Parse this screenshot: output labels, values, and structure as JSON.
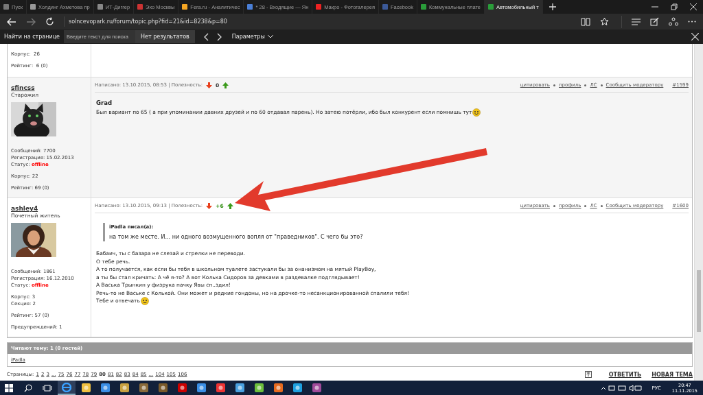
{
  "browser": {
    "tabs": [
      {
        "title": "Пуск",
        "selected": false
      },
      {
        "title": "Холдинг Ахметова пр",
        "selected": false
      },
      {
        "title": "ИТ-Диггер",
        "selected": false
      },
      {
        "title": "Эхо Москвы",
        "selected": false
      },
      {
        "title": "Fera.ru - Аналитичес",
        "selected": false
      },
      {
        "title": "* 28 - Входящие — Ян",
        "selected": false
      },
      {
        "title": "Макро - Фотогалерея",
        "selected": false
      },
      {
        "title": "Facebook",
        "selected": false
      },
      {
        "title": "Коммунальные плате",
        "selected": false
      },
      {
        "title": "Автомобильный т",
        "selected": true
      }
    ],
    "url": "solncevopark.ru/forum/topic.php?fid=21&id=8238&p=80",
    "find": {
      "label": "Найти на странице",
      "placeholder": "Введите текст для поиска",
      "result": "Нет результатов",
      "options": "Параметры"
    }
  },
  "forum": {
    "partial_row": {
      "stat_groups": [
        [
          {
            "label": "Корпус:",
            "value": "26"
          }
        ],
        [
          {
            "label": "Рейтинг:",
            "value": "6 (0)"
          }
        ]
      ]
    },
    "posts": [
      {
        "author": "sfincss",
        "rank": "Старожил",
        "stat_groups": [
          [
            {
              "label": "Сообщений:",
              "value": "7700",
              "kind": "plain"
            },
            {
              "label": "Регистрация:",
              "value": "15.02.2013",
              "kind": "plain"
            },
            {
              "label": "Статус:",
              "value": "offline",
              "kind": "status"
            }
          ],
          [
            {
              "label": "Корпус:",
              "value": "22",
              "kind": "plain"
            }
          ],
          [
            {
              "label": "Рейтинг:",
              "value": "69 (0)",
              "kind": "plain"
            }
          ]
        ],
        "written": "Написано: 13.10.2015, 08:53 | Полезность:",
        "score": "0",
        "positive": false,
        "actions": [
          "цитировать",
          "профиль",
          "ЛС",
          "Сообщить модератору"
        ],
        "number": "#1599",
        "heading": "Grad",
        "paragraphs": [
          "Был вариант по 65 ( а при упоминании давних друзей и по 60 отдавал парень). Но затею потёрли, ибо был конкурент если помнишь тут"
        ]
      },
      {
        "author": "ashley4",
        "rank": "Почетный житель",
        "stat_groups": [
          [
            {
              "label": "Сообщений:",
              "value": "1861",
              "kind": "plain"
            },
            {
              "label": "Регистрация:",
              "value": "16.12.2010",
              "kind": "plain"
            },
            {
              "label": "Статус:",
              "value": "offline",
              "kind": "status"
            }
          ],
          [
            {
              "label": "Корпус:",
              "value": "3",
              "kind": "plain"
            },
            {
              "label": "Секция:",
              "value": "2",
              "kind": "plain"
            }
          ],
          [
            {
              "label": "Рейтинг:",
              "value": "57 (0)",
              "kind": "plain"
            }
          ],
          [
            {
              "label": "Предупреждений:",
              "value": "1",
              "kind": "plain"
            }
          ]
        ],
        "written": "Написано: 13.10.2015, 09:13 | Полезность:",
        "score": "+6",
        "positive": true,
        "actions": [
          "цитировать",
          "профиль",
          "ЛС",
          "Сообщить модератору"
        ],
        "number": "#1600",
        "quote": {
          "author": "iPadla писал(а):",
          "text": "на том же месте. И... ни одного возмущенного вопля от \"праведников\". С чего бы это?"
        },
        "paragraphs": [
          "Бабаич, ты с базара не слезай и стрелки не переводи.",
          "О тебе речь.",
          "А то получается, как если бы тебя в школьном туалете застукали бы за онанизмом на мятый PlayBoy,",
          "а ты бы стал кричать: А чё я-то? А вот Колька Сидоров за девками в раздевалке подглядывает!",
          "А Васька Трынкин у физрука пачку Явы сп..здил!",
          "Речь-то не Ваське с Колькой. Они может и редкие гондоны, но на дрочке-то несанкционированной спалили тебя!",
          "Тебе и отвечать"
        ]
      }
    ],
    "readers_header": "Читают тему: 1 (0 гостей)",
    "readers": [
      "iPadla"
    ],
    "pages_label": "Страницы:",
    "pages": [
      {
        "label": "1",
        "selected": false
      },
      {
        "label": "2",
        "selected": false
      },
      {
        "label": "3",
        "selected": false
      },
      {
        "label": "...",
        "selected": false
      },
      {
        "label": "75",
        "selected": false
      },
      {
        "label": "76",
        "selected": false
      },
      {
        "label": "77",
        "selected": false
      },
      {
        "label": "78",
        "selected": false
      },
      {
        "label": "79",
        "selected": false
      },
      {
        "label": "80",
        "selected": true
      },
      {
        "label": "81",
        "selected": false
      },
      {
        "label": "82",
        "selected": false
      },
      {
        "label": "83",
        "selected": false
      },
      {
        "label": "84",
        "selected": false
      },
      {
        "label": "85",
        "selected": false
      },
      {
        "label": "...",
        "selected": false
      },
      {
        "label": "104",
        "selected": false
      },
      {
        "label": "105",
        "selected": false
      },
      {
        "label": "106",
        "selected": false
      }
    ],
    "buttons": [
      "ОТВЕТИТЬ",
      "НОВАЯ ТЕМА"
    ]
  },
  "taskbar": {
    "language": "РУС",
    "time": "20:47",
    "date": "11.11.2015"
  }
}
